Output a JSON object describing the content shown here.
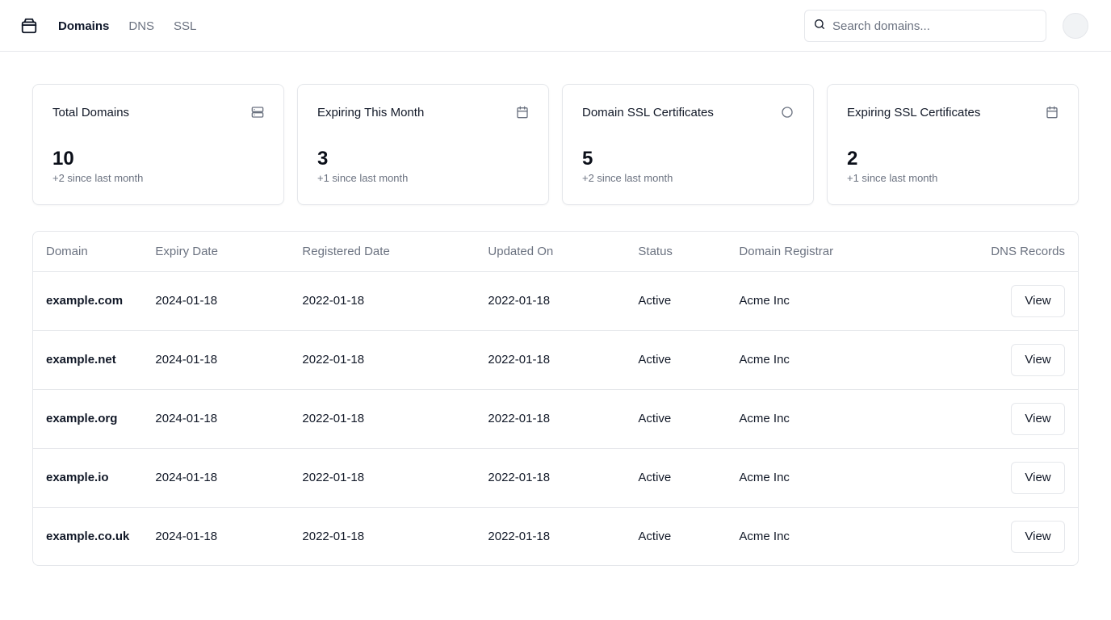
{
  "header": {
    "logo_icon": "package-icon",
    "nav": [
      {
        "label": "Domains",
        "active": true
      },
      {
        "label": "DNS",
        "active": false
      },
      {
        "label": "SSL",
        "active": false
      }
    ],
    "search": {
      "placeholder": "Search domains...",
      "value": ""
    }
  },
  "stats": [
    {
      "title": "Total Domains",
      "icon": "server-icon",
      "value": "10",
      "sub": "+2 since last month"
    },
    {
      "title": "Expiring This Month",
      "icon": "calendar-icon",
      "value": "3",
      "sub": "+1 since last month"
    },
    {
      "title": "Domain SSL Certificates",
      "icon": "circle-icon",
      "value": "5",
      "sub": "+2 since last month"
    },
    {
      "title": "Expiring SSL Certificates",
      "icon": "calendar-icon",
      "value": "2",
      "sub": "+1 since last month"
    }
  ],
  "table": {
    "columns": [
      "Domain",
      "Expiry Date",
      "Registered Date",
      "Updated On",
      "Status",
      "Domain Registrar",
      "DNS Records"
    ],
    "rows": [
      {
        "domain": "example.com",
        "expiry": "2024-01-18",
        "registered": "2022-01-18",
        "updated": "2022-01-18",
        "status": "Active",
        "registrar": "Acme Inc",
        "action": "View"
      },
      {
        "domain": "example.net",
        "expiry": "2024-01-18",
        "registered": "2022-01-18",
        "updated": "2022-01-18",
        "status": "Active",
        "registrar": "Acme Inc",
        "action": "View"
      },
      {
        "domain": "example.org",
        "expiry": "2024-01-18",
        "registered": "2022-01-18",
        "updated": "2022-01-18",
        "status": "Active",
        "registrar": "Acme Inc",
        "action": "View"
      },
      {
        "domain": "example.io",
        "expiry": "2024-01-18",
        "registered": "2022-01-18",
        "updated": "2022-01-18",
        "status": "Active",
        "registrar": "Acme Inc",
        "action": "View"
      },
      {
        "domain": "example.co.uk",
        "expiry": "2024-01-18",
        "registered": "2022-01-18",
        "updated": "2022-01-18",
        "status": "Active",
        "registrar": "Acme Inc",
        "action": "View"
      }
    ]
  }
}
